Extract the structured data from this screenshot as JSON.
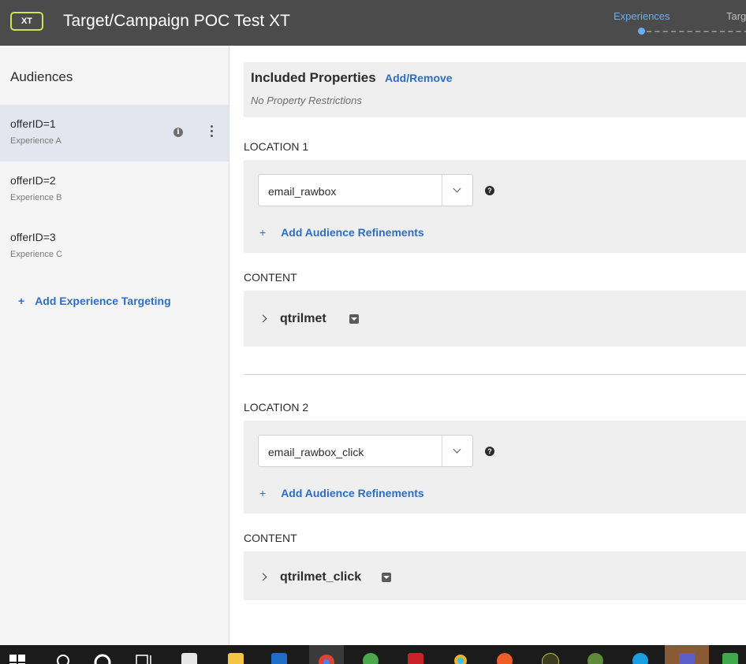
{
  "header": {
    "badge": "XT",
    "title": "Target/Campaign POC Test XT",
    "steps": [
      "Experiences",
      "Targ"
    ],
    "accent_color": "#6aaef0",
    "badge_color": "#d2e15a"
  },
  "sidebar": {
    "title": "Audiences",
    "audiences": [
      {
        "name": "offerID=1",
        "experience": "Experience A",
        "selected": true
      },
      {
        "name": "offerID=2",
        "experience": "Experience B",
        "selected": false
      },
      {
        "name": "offerID=3",
        "experience": "Experience C",
        "selected": false
      }
    ],
    "add_label": "Add Experience Targeting",
    "plus": "+"
  },
  "main": {
    "properties": {
      "title": "Included Properties",
      "link": "Add/Remove",
      "note": "No Property Restrictions"
    },
    "locations": [
      {
        "label": "LOCATION 1",
        "mbox": "email_rawbox",
        "refine_label": "Add Audience Refinements",
        "content_label": "CONTENT",
        "content_name": "qtrilmet"
      },
      {
        "label": "LOCATION 2",
        "mbox": "email_rawbox_click",
        "refine_label": "Add Audience Refinements",
        "content_label": "CONTENT",
        "content_name": "qtrilmet_click"
      }
    ],
    "link_color": "#2d6ec2"
  },
  "taskbar": {
    "icons": [
      "windows-start-icon",
      "search-icon",
      "cortana-icon",
      "task-view-icon",
      "store-icon",
      "file-explorer-icon",
      "outlook-icon",
      "chrome-icon",
      "xbox-icon",
      "filezilla-icon",
      "slack-icon",
      "postman-icon",
      "app-icon",
      "paint-icon",
      "edge-icon",
      "teams-icon",
      "android-icon"
    ]
  }
}
